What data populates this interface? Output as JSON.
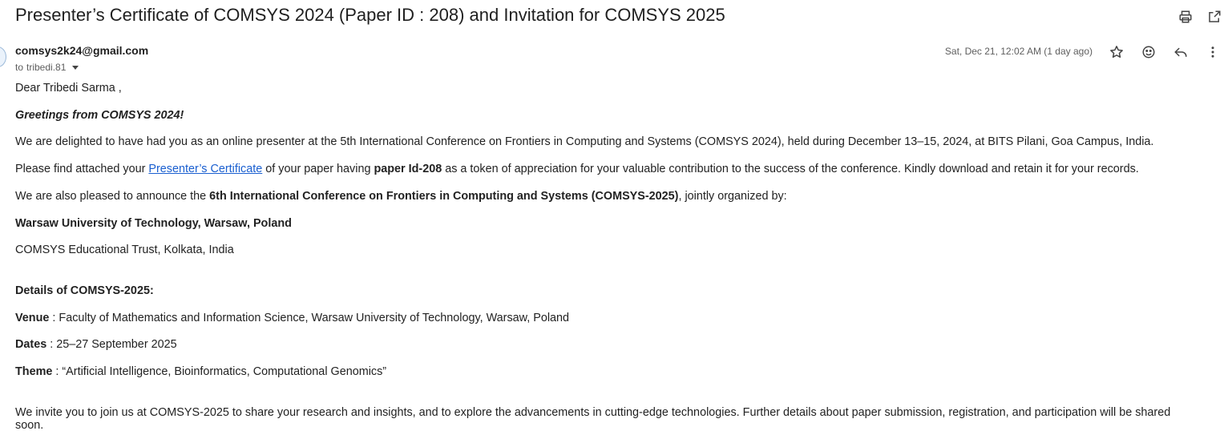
{
  "email": {
    "subject": "Presenter’s Certificate of COMSYS 2024 (Paper ID : 208) and Invitation for COMSYS 2025",
    "sender": "comsys2k24@gmail.com",
    "recipient_prefix": "to",
    "recipient": "tribedi.81",
    "date": "Sat, Dec 21, 12:02 AM (1 day ago)"
  },
  "toolbar_icons": [
    "print-icon",
    "open-in-new-window-icon"
  ],
  "action_icons": [
    "star-icon",
    "emoji-reaction-icon",
    "reply-icon",
    "more-options-icon"
  ],
  "body": {
    "greeting": "Dear  Tribedi Sarma ,",
    "greetings_line": "Greetings from COMSYS 2024!",
    "p1": "We are delighted to have had you as an online presenter at the 5th International Conference on Frontiers in Computing and Systems (COMSYS 2024), held during December 13–15, 2024, at BITS Pilani, Goa Campus, India.",
    "p2_before": "Please find attached your ",
    "p2_link": "Presenter’s Certificate",
    "p2_mid": " of your paper having ",
    "p2_bold": "paper Id-208",
    "p2_after": " as a token of appreciation for your valuable contribution to the success of the conference. Kindly download and retain it for your records.",
    "p3_before": "We are also pleased to announce the ",
    "p3_bold": "6th International Conference on Frontiers in Computing and Systems (COMSYS-2025)",
    "p3_after": ", jointly organized by:",
    "org1": "Warsaw University of Technology, Warsaw, Poland",
    "org2": "COMSYS Educational Trust, Kolkata, India",
    "details_heading": "Details of COMSYS-2025:",
    "venue_label": "Venue",
    "venue_value": " : Faculty of Mathematics and Information Science, Warsaw University of Technology, Warsaw, Poland",
    "dates_label": "Dates",
    "dates_value": " : 25–27 September 2025",
    "theme_label": "Theme",
    "theme_value": " : “Artificial Intelligence, Bioinformatics, Computational Genomics”",
    "closing": "We invite you to join us at COMSYS-2025 to share your research and insights, and to explore the advancements in cutting-edge technologies. Further details about paper submission, registration, and participation will be shared soon."
  }
}
